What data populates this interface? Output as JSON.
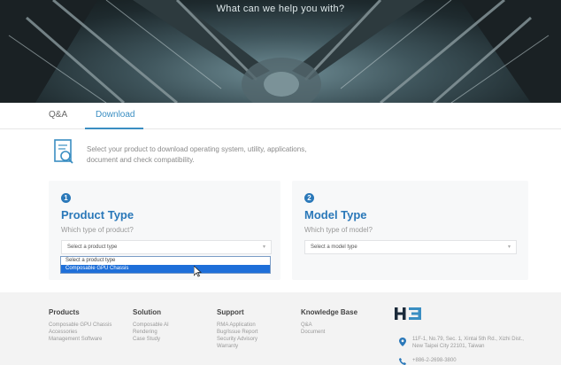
{
  "hero": {
    "title": "What can we help you with?"
  },
  "tabs": [
    {
      "label": "Q&A",
      "active": false
    },
    {
      "label": "Download",
      "active": true
    }
  ],
  "intro": {
    "text": "Select your product to download operating system, utility, applications, document and check compatibility."
  },
  "product_type": {
    "step": "1",
    "title": "Product Type",
    "subtitle": "Which type of product?",
    "selected": "Select a product type",
    "options": [
      "Select a product type",
      "Composable GPU Chassis"
    ],
    "highlighted_index": 1
  },
  "model_type": {
    "step": "2",
    "title": "Model Type",
    "subtitle": "Which type of model?",
    "selected": "Select a model type"
  },
  "footer": {
    "columns": [
      {
        "heading": "Products",
        "links": [
          "Composable GPU Chassis",
          "Accessories",
          "Management Software"
        ]
      },
      {
        "heading": "Solution",
        "links": [
          "Composable AI",
          "Rendering",
          "Case Study"
        ]
      },
      {
        "heading": "Support",
        "links": [
          "RMA Application",
          "Bug/Issue Report",
          "Security Advisory",
          "Warranty"
        ]
      },
      {
        "heading": "Knowledge Base",
        "links": [
          "Q&A",
          "Document"
        ]
      }
    ],
    "address": "11F-1, No.79, Sec. 1, Xintai 5th Rd., Xizhi Dist., New Taipei City 22101, Taiwan",
    "phone": "+886-2-2698-3800"
  },
  "colors": {
    "accent": "#2a78b9",
    "tab_active": "#3a8ec2",
    "highlight": "#1e6fd9"
  },
  "icons": [
    "document-search-icon",
    "location-pin-icon",
    "phone-icon",
    "chevron-down-icon",
    "mouse-pointer-icon",
    "h3-logo"
  ]
}
